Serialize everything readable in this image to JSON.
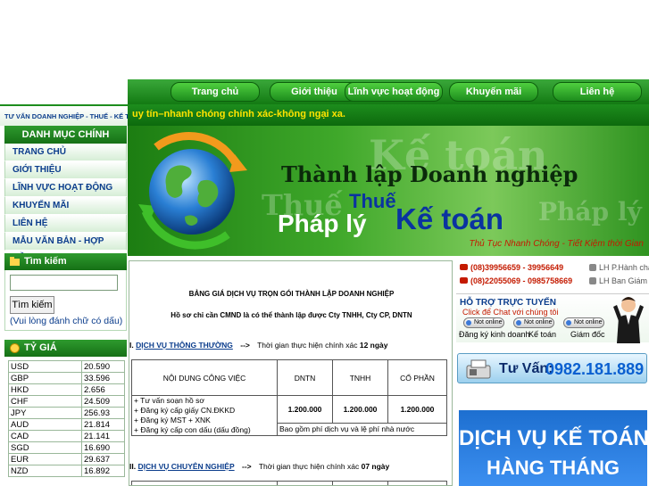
{
  "nav": {
    "items": [
      "Trang chủ",
      "Giới thiệu",
      "Lĩnh vực hoạt động",
      "Khuyến mãi",
      "Liên hệ"
    ]
  },
  "left_header": "TƯ VẤN DOANH NGHIỆP - THUẾ - KẾ TOÁN",
  "marquee": "uy tín–nhanh chóng chính xác-không ngại xa.",
  "banner": {
    "line1": "Thành lập Doanh nghiệp",
    "line2": "Thuế",
    "line3": "Pháp lý",
    "line4": "Kế toán",
    "slogan": "Thủ Tục Nhanh Chóng - Tiết Kiệm thời Gian",
    "watermark1": "Kế toán",
    "watermark2": "Thuế",
    "watermark3": "Pháp lý"
  },
  "menu": {
    "title": "DANH MỤC CHÍNH",
    "items": [
      "TRANG CHỦ",
      "GIỚI THIỆU",
      "LĨNH VỰC HOẠT ĐỘNG",
      "KHUYẾN MÃI",
      "LIÊN HỆ",
      "MẪU VĂN BẢN - HỢP ĐỒNG"
    ]
  },
  "search": {
    "title": "Tìm kiếm",
    "value": "",
    "button": "Tìm kiếm",
    "hint": "(Vui lòng đánh chữ có dấu)"
  },
  "rates": {
    "title": "TỶ GIÁ",
    "rows": [
      [
        "USD",
        "20.590"
      ],
      [
        "GBP",
        "33.596"
      ],
      [
        "HKD",
        "2.656"
      ],
      [
        "CHF",
        "24.509"
      ],
      [
        "JPY",
        "256.93"
      ],
      [
        "AUD",
        "21.814"
      ],
      [
        "CAD",
        "21.141"
      ],
      [
        "SGD",
        "16.690"
      ],
      [
        "EUR",
        "29.637"
      ],
      [
        "NZD",
        "16.892"
      ]
    ]
  },
  "main": {
    "title": "BẢNG GIÁ DỊCH VỤ TRỌN GÓI THÀNH LẬP DOANH NGHIỆP",
    "subtitle": "Hồ sơ chỉ cần CMND là có thể thành lập được Cty TNHH, Cty CP, DNTN",
    "section1": {
      "prefix": "I.",
      "name": "DỊCH VỤ THÔNG THƯỜNG",
      "arrow": "-->",
      "time_label": "Thời gian thực hiện chính xác",
      "time_value": "12 ngày"
    },
    "table": {
      "headers": [
        "NỘI DUNG CÔNG VIỆC",
        "DNTN",
        "TNHH",
        "CỔ PHẦN"
      ],
      "services": [
        "+ Tư vấn soạn hồ sơ",
        "+ Đăng ký cấp giấy CN.ĐKKD",
        "+ Đăng ký MST + XNK",
        "+ Đăng ký cấp con dấu (dấu đồng)"
      ],
      "prices": [
        "1.200.000",
        "1.200.000",
        "1.200.000"
      ],
      "note": "Bao gồm phí dịch vụ và lệ phí nhà nước"
    },
    "section2": {
      "prefix": "II.",
      "name": "DỊCH VỤ CHUYÊN NGHIỆP",
      "arrow": "-->",
      "time_label": "Thời gian thực hiện chính xác",
      "time_value": "07 ngày"
    }
  },
  "hotline": [
    {
      "number": "(08)39956659 - 39956649",
      "label": "LH P.Hành chánh"
    },
    {
      "number": "(08)22055069 - 0985758669",
      "label": "LH Ban Giám Đốc"
    }
  ],
  "support": {
    "title": "HỖ TRỢ TRỰC TUYẾN",
    "chat_prompt": "Click để Chat với chúng tôi",
    "badge": "Not online",
    "agents": [
      "Đăng ký kinh doanh",
      "Kế toán",
      "Giám đốc"
    ]
  },
  "tuvan": {
    "label": "Tư Vấn:",
    "number": "0982.181.889"
  },
  "ad": {
    "line1": "DỊCH VỤ KẾ TOÁN",
    "line2": "HÀNG THÁNG"
  },
  "colors": {
    "green_dark": "#167016",
    "green_bright": "#3fa82a",
    "link_blue": "#0b3d8c",
    "accent_red": "#c41a00",
    "marquee_yellow": "#ffe300"
  }
}
